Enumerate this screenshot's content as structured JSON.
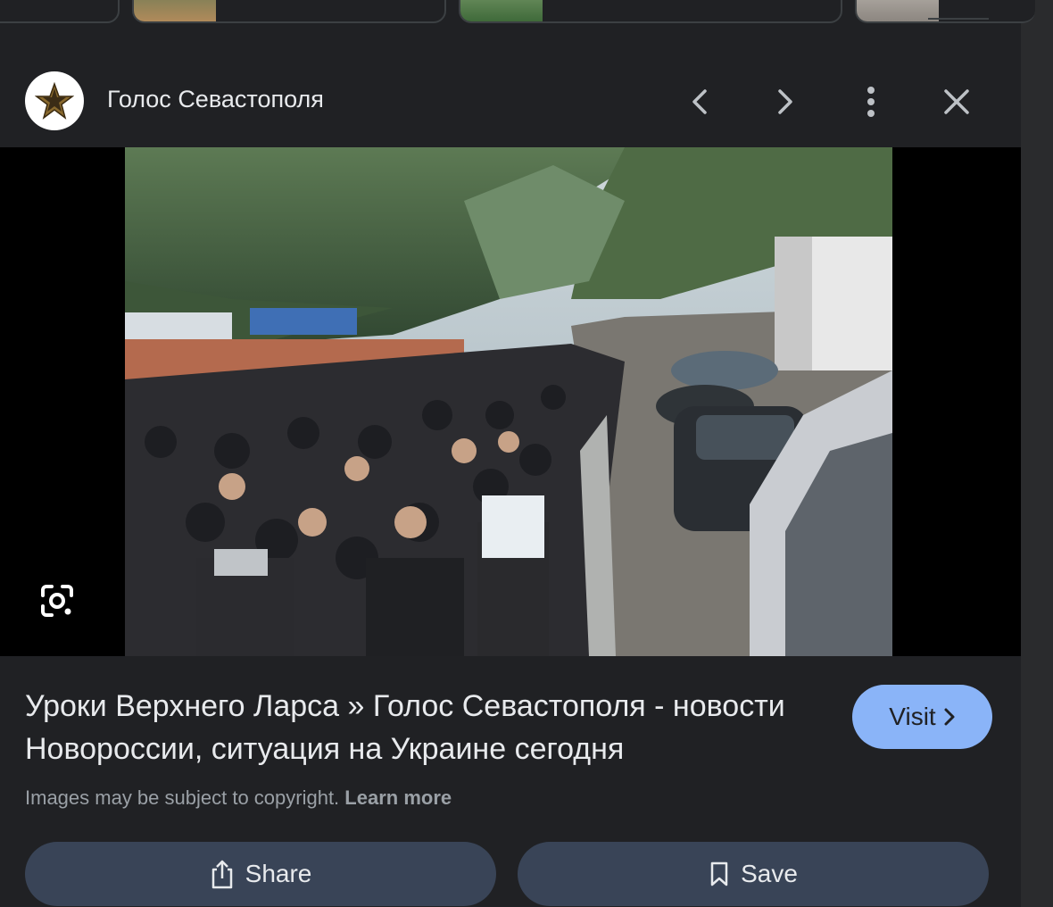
{
  "header": {
    "source_name": "Голос Севастополя",
    "avatar_icon": "star-logo",
    "prev_icon": "chevron-left-icon",
    "next_icon": "chevron-right-icon",
    "more_icon": "more-vert-icon",
    "close_icon": "close-icon"
  },
  "image": {
    "lens_icon": "google-lens-icon"
  },
  "info": {
    "title": "Уроки Верхнего Ларса » Голос Севастополя - новости Новороссии, ситуация на Украине сегодня",
    "visit_label": "Visit",
    "copyright_text": "Images may be subject to copyright.",
    "learn_more": "Learn more"
  },
  "actions": {
    "share_label": "Share",
    "save_label": "Save"
  },
  "colors": {
    "background": "#202124",
    "accent": "#8ab4f8",
    "action_button": "#394457"
  }
}
